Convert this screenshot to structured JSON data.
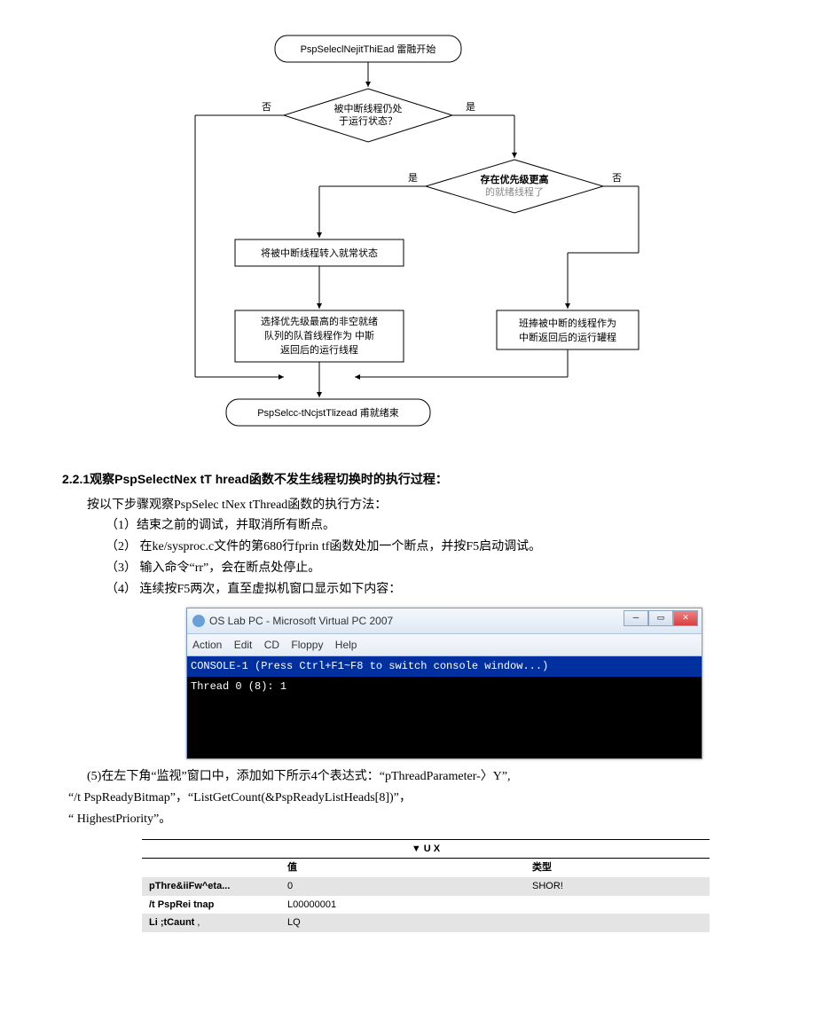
{
  "flowchart": {
    "start": "PspSeleclNejitThiEad 雷融开始",
    "decision1": {
      "line1": "被中断线程仍处",
      "line2": "于运行状态？"
    },
    "no_label": "否",
    "yes_label": "是",
    "decision2": {
      "line1": "存在优先级更高",
      "line2": "的就绪线程了"
    },
    "box_move": "将被中断线程转入就常状态",
    "box_left": {
      "line1": "选择优先级最高的非空就绪",
      "line2": "队列的队首线程作为 中斯",
      "line3": "返回后的运行线程"
    },
    "box_right": {
      "line1": "班捧被中断的线程作为",
      "line2": "中断返回后的运行罐程"
    },
    "end": "PspSelcc-tNcjstTlizead 甫就绪束"
  },
  "section_title": "2.2.1观察PspSelectNex tT hread函数不发生线程切换时的执行过程：",
  "intro": "按以下步骤观察PspSelec tNex tThread函数的执行方法：",
  "steps": {
    "s1": "（1）结束之前的调试，并取消所有断点。",
    "s2": "（2） 在ke/sysproc.c文件的第680行fprin tf函数处加一个断点，并按F5启动调试。",
    "s3": "（3） 输入命令“rr”，会在断点处停止。",
    "s4": "（4） 连续按F5两次，直至虚拟机窗口显示如下内容："
  },
  "vpc": {
    "title": "OS Lab PC - Microsoft Virtual PC 2007",
    "menu": [
      "Action",
      "Edit",
      "CD",
      "Floppy",
      "Help"
    ],
    "console_line1": "CONSOLE-1 (Press Ctrl+F1~F8 to switch console window...)",
    "console_line2": "Thread 0 (8): 1"
  },
  "step5": "(5)在左下角“监视”窗口中，添加如下所示4个表达式：“pThreadParameter-〉Y”,",
  "exprs": "“/t PspReadyBitmap”，“ListGetCount(&PspReadyListHeads[8])”，",
  "exprs2": "“ HighestPriority”。",
  "watch": {
    "header": "▼ U X",
    "col_value": "值",
    "col_type": "类型",
    "rows": [
      {
        "name": "pThre&iiFw^eta...",
        "value": "0",
        "type": "SHOR!"
      },
      {
        "name": "/t PspRei tnap",
        "value": "L00000001",
        "type": ""
      },
      {
        "name": "Li ;tCaunt",
        "value": "LQ",
        "type": ""
      }
    ]
  }
}
